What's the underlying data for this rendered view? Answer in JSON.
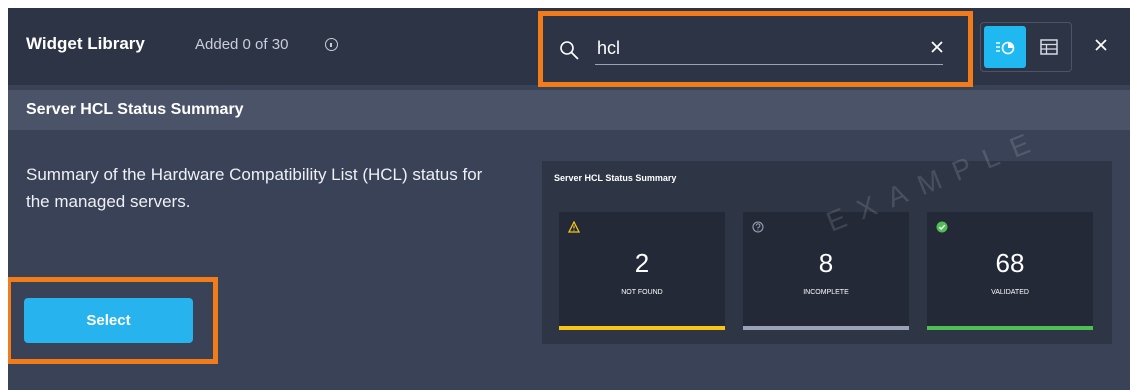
{
  "header": {
    "title": "Widget Library",
    "added_text": "Added 0 of 30"
  },
  "search": {
    "value": "hcl",
    "placeholder": ""
  },
  "view_toggle": {
    "options": [
      "chart-view-icon",
      "table-view-icon"
    ],
    "active": "chart-view-icon"
  },
  "widget": {
    "name": "Server HCL Status Summary",
    "description": "Summary of the Hardware Compatibility List (HCL) status for the managed servers.",
    "select_label": "Select"
  },
  "preview": {
    "title": "Server HCL Status Summary",
    "watermark": "EXAMPLE",
    "tiles": [
      {
        "value": "2",
        "label": "NOT FOUND",
        "icon": "warning-icon",
        "color": "#f5c518"
      },
      {
        "value": "8",
        "label": "INCOMPLETE",
        "icon": "help-icon",
        "color": "#9aa2b5"
      },
      {
        "value": "68",
        "label": "VALIDATED",
        "icon": "check-icon",
        "color": "#4fbf55"
      }
    ]
  },
  "colors": {
    "accent": "#27b3ee",
    "highlight": "#f27b1a",
    "header_bg": "#2d3446",
    "panel_bg": "#3a4257"
  }
}
